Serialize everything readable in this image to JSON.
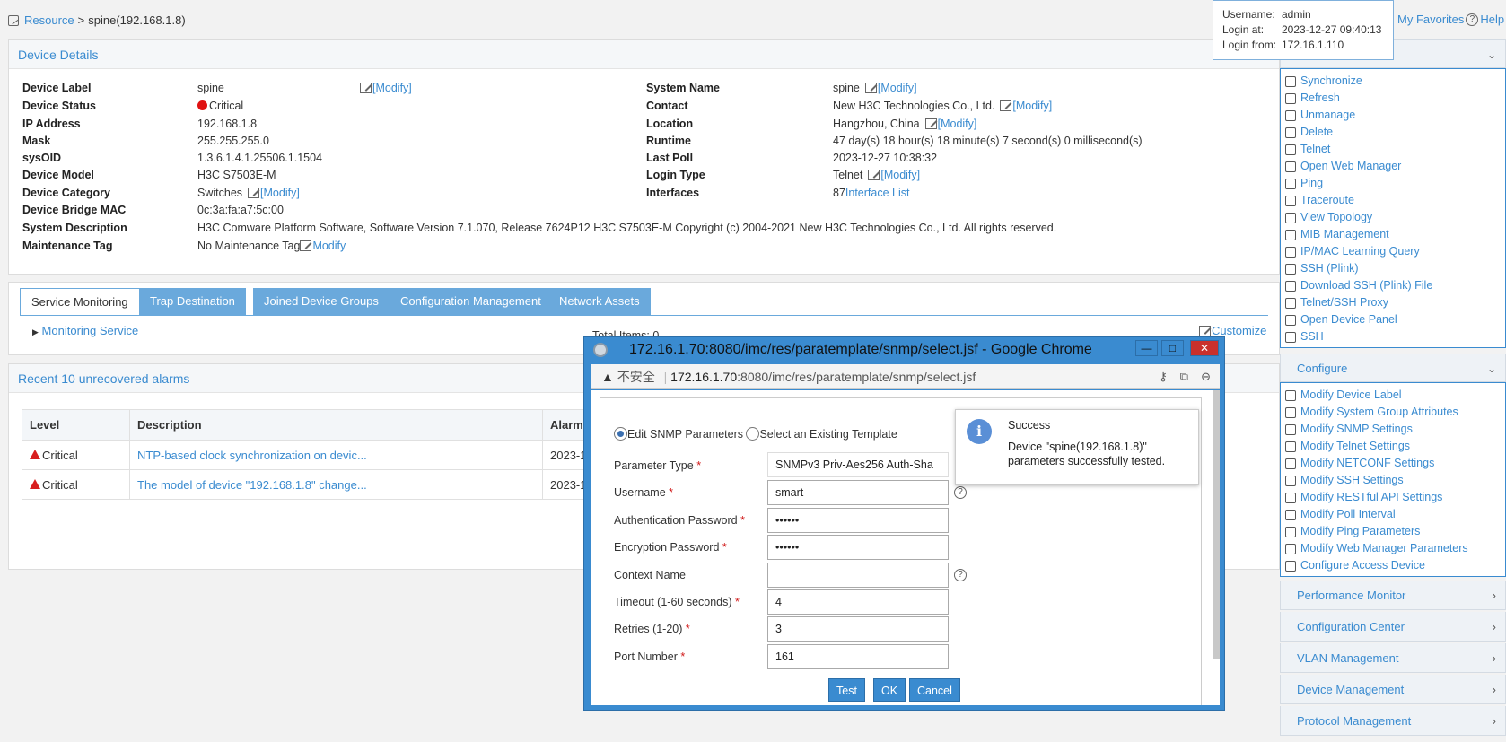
{
  "breadcrumb": {
    "root": "Resource",
    "separator": ">",
    "current": "spine(192.168.1.8)"
  },
  "login": {
    "username_label": "Username:",
    "username": "admin",
    "login_at_label": "Login at:",
    "login_at": "2023-12-27 09:40:13",
    "login_from_label": "Login from:",
    "login_from": "172.16.1.110"
  },
  "topright": {
    "favorites": "My Favorites",
    "help": "Help",
    "help_glyph": "?"
  },
  "details": {
    "title": "Device Details",
    "modify": "[Modify]",
    "left": {
      "device_label_k": "Device Label",
      "device_label_v": "spine",
      "device_status_k": "Device Status",
      "device_status_v": "Critical",
      "ip_k": "IP Address",
      "ip_v": "192.168.1.8",
      "mask_k": "Mask",
      "mask_v": "255.255.255.0",
      "sysoid_k": "sysOID",
      "sysoid_v": "1.3.6.1.4.1.25506.1.1504",
      "model_k": "Device Model",
      "model_v": "H3C S7503E-M",
      "category_k": "Device Category",
      "category_v": "Switches",
      "mac_k": "Device Bridge MAC",
      "mac_v": "0c:3a:fa:a7:5c:00",
      "sysdesc_k": "System Description",
      "sysdesc_v": "H3C Comware Platform Software, Software Version 7.1.070, Release 7624P12 H3C S7503E-M Copyright (c) 2004-2021 New H3C Technologies Co., Ltd. All rights reserved.",
      "maint_k": "Maintenance Tag",
      "maint_v": "No Maintenance Tag",
      "maint_link": "Modify"
    },
    "right": {
      "sysname_k": "System Name",
      "sysname_v": "spine",
      "contact_k": "Contact",
      "contact_v": "New H3C Technologies Co., Ltd.",
      "location_k": "Location",
      "location_v": "Hangzhou, China",
      "runtime_k": "Runtime",
      "runtime_v": "47 day(s) 18 hour(s) 18 minute(s) 7 second(s) 0 millisecond(s)",
      "lastpoll_k": "Last Poll",
      "lastpoll_v": "2023-12-27 10:38:32",
      "logintype_k": "Login Type",
      "logintype_v": "Telnet",
      "interfaces_k": "Interfaces",
      "interfaces_v": "87",
      "interfaces_link": "Interface List"
    }
  },
  "tabs": [
    "Service Monitoring",
    "Trap Destination",
    "Joined Device Groups",
    "Configuration Management",
    "Network Assets"
  ],
  "monitoring": {
    "link": "Monitoring Service",
    "total": "Total Items: 0",
    "customize": "Customize"
  },
  "alarms": {
    "title": "Recent 10 unrecovered alarms",
    "headers": [
      "Level",
      "Description",
      "Alarm"
    ],
    "rows": [
      {
        "level": "Critical",
        "desc": "NTP-based clock synchronization on devic...",
        "time": "2023-1"
      },
      {
        "level": "Critical",
        "desc": "The model of device \"192.168.1.8\" change...",
        "time": "2023-1"
      }
    ]
  },
  "sidebar": {
    "actions": [
      "Synchronize",
      "Refresh",
      "Unmanage",
      "Delete",
      "Telnet",
      "Open Web Manager",
      "Ping",
      "Traceroute",
      "View Topology",
      "MIB Management",
      "IP/MAC Learning Query",
      "SSH (Plink)",
      "Download SSH (Plink) File",
      "Telnet/SSH Proxy",
      "Open Device Panel",
      "SSH"
    ],
    "configure_title": "Configure",
    "configure": [
      "Modify Device Label",
      "Modify System Group Attributes",
      "Modify SNMP Settings",
      "Modify Telnet Settings",
      "Modify NETCONF Settings",
      "Modify SSH Settings",
      "Modify RESTful API Settings",
      "Modify Poll Interval",
      "Modify Ping Parameters",
      "Modify Web Manager Parameters",
      "Configure Access Device"
    ],
    "sections": [
      "Performance Monitor",
      "Configuration Center",
      "VLAN Management",
      "Device Management",
      "Protocol Management"
    ],
    "chevron_down": "⌄",
    "chevron_right": "›"
  },
  "dialog": {
    "title": "172.16.1.70:8080/imc/res/paratemplate/snmp/select.jsf - Google Chrome",
    "insecure": "不安全",
    "url_host": "172.16.1.70",
    "url_rest": ":8080/imc/res/paratemplate/snmp/select.jsf",
    "btn_min": "—",
    "btn_max": "□",
    "btn_close": "✕",
    "addr_icons": [
      "⚷",
      "⧉",
      "⊖"
    ],
    "radio_edit": "Edit SNMP Parameters",
    "radio_select": "Select an Existing Template",
    "fields": {
      "param_type_label": "Parameter Type",
      "param_type": "SNMPv3 Priv-Aes256 Auth-Sha",
      "username_label": "Username",
      "username": "smart",
      "auth_label": "Authentication Password",
      "auth": "••••••",
      "enc_label": "Encryption Password",
      "enc": "••••••",
      "context_label": "Context Name",
      "context": "",
      "timeout_label": "Timeout (1-60 seconds)",
      "timeout": "4",
      "retries_label": "Retries (1-20)",
      "retries": "3",
      "port_label": "Port Number",
      "port": "161"
    },
    "buttons": {
      "test": "Test",
      "ok": "OK",
      "cancel": "Cancel"
    }
  },
  "toast": {
    "title": "Success",
    "message": "Device \"spine(192.168.1.8)\" parameters successfully tested.",
    "icon": "i"
  },
  "colors": {
    "accent": "#3a8bd0",
    "critical": "#e01212"
  }
}
